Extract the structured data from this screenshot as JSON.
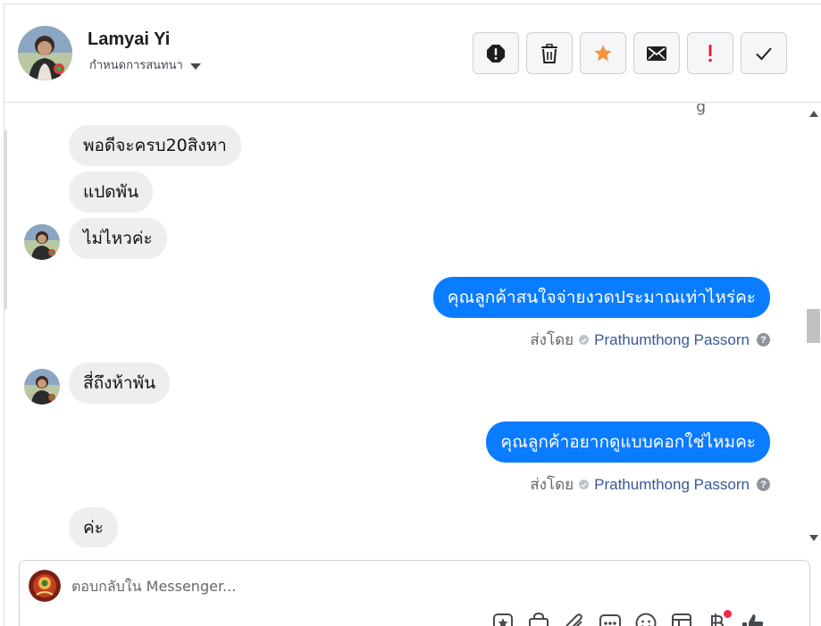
{
  "header": {
    "contact_name": "Lamyai Yi",
    "assign_label": "กำหนดการสนทนา",
    "toolbar": [
      {
        "icon": "alert-octagon-icon",
        "label": "spam"
      },
      {
        "icon": "trash-icon",
        "label": "delete"
      },
      {
        "icon": "star-icon",
        "label": "star"
      },
      {
        "icon": "envelope-icon",
        "label": "mark-unread"
      },
      {
        "icon": "exclamation-icon",
        "label": "follow-up"
      },
      {
        "icon": "checkmark-icon",
        "label": "done"
      }
    ]
  },
  "colors": {
    "outgoing_bubble": "#0a7cff",
    "incoming_bubble": "#eeeeee",
    "star": "#f7923b",
    "exclamation": "#e41e3f",
    "agent_link": "#385898"
  },
  "messages": {
    "m1": "พอดีจะครบ20สิงหา",
    "m2": "แปดพัน",
    "m3": "ไม่ไหวค่ะ",
    "m4": "คุณลูกค้าสนใจจ่ายงวดประมาณเท่าไหร่คะ",
    "m5": "สี่ถึงห้าพัน",
    "m6": "คุณลูกค้าอยากดูแบบคอกใช่ไหมคะ",
    "m7": "ค่ะ"
  },
  "sent_by": {
    "label": "ส่งโดย",
    "agent": "Prathumthong Passorn",
    "help": "?"
  },
  "composer": {
    "placeholder": "ตอบกลับใน Messenger..."
  }
}
